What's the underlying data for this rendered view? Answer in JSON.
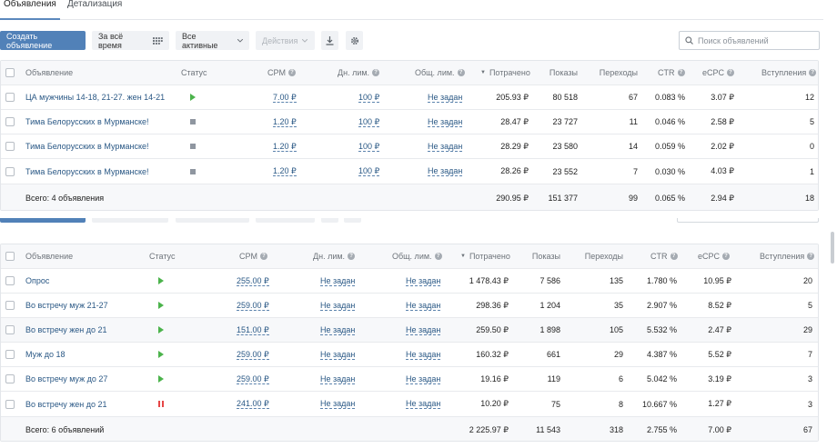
{
  "tabs": [
    {
      "label": "Объявления",
      "active": true
    },
    {
      "label": "Детализация",
      "active": false
    }
  ],
  "toolbar": {
    "create_label": "Создать объявление",
    "period_label": "За всё время",
    "filter_label": "Все активные",
    "actions_label": "Действия",
    "download_icon": "download-icon",
    "settings_icon": "gear-icon",
    "search_placeholder": "Поиск объявлений"
  },
  "colors": {
    "primary": "#5181b8",
    "link": "#2a5885",
    "status_active": "#4bb34b",
    "status_paused": "#e64646",
    "status_stopped": "#8f96a0"
  },
  "table1": {
    "headers": {
      "ad": "Объявление",
      "status": "Статус",
      "cpm": "CPM",
      "daily": "Дн. лим.",
      "total": "Общ. лим.",
      "spent": "Потрачено",
      "impressions": "Показы",
      "clicks": "Переходы",
      "ctr": "CTR",
      "ecpc": "eCPC",
      "joins": "Вступления"
    },
    "rows": [
      {
        "name": "ЦА мужчины 14-18, 21-27. жен 14-21",
        "status": "active",
        "cpm": "7.00 ₽",
        "daily": "100 ₽",
        "total": "Не задан",
        "spent": "205.93 ₽",
        "impressions": "80 518",
        "clicks": "67",
        "ctr": "0.083 %",
        "ecpc": "3.07 ₽",
        "joins": "12"
      },
      {
        "name": "Тима Белорусских в Мурманске!",
        "status": "stopped",
        "cpm": "1.20 ₽",
        "daily": "100 ₽",
        "total": "Не задан",
        "spent": "28.47 ₽",
        "impressions": "23 727",
        "clicks": "11",
        "ctr": "0.046 %",
        "ecpc": "2.58 ₽",
        "joins": "5"
      },
      {
        "name": "Тима Белорусских в Мурманске!",
        "status": "stopped",
        "cpm": "1.20 ₽",
        "daily": "100 ₽",
        "total": "Не задан",
        "spent": "28.29 ₽",
        "impressions": "23 580",
        "clicks": "14",
        "ctr": "0.059 %",
        "ecpc": "2.02 ₽",
        "joins": "0"
      },
      {
        "name": "Тима Белорусских в Мурманске!",
        "status": "stopped",
        "cpm": "1.20 ₽",
        "daily": "100 ₽",
        "total": "Не задан",
        "spent": "28.26 ₽",
        "impressions": "23 552",
        "clicks": "7",
        "ctr": "0.030 %",
        "ecpc": "4.03 ₽",
        "joins": "1"
      }
    ],
    "total": {
      "label": "Всего: 4 объявления",
      "spent": "290.95 ₽",
      "impressions": "151 377",
      "clicks": "99",
      "ctr": "0.065 %",
      "ecpc": "2.94 ₽",
      "joins": "18"
    }
  },
  "table2": {
    "headers": {
      "ad": "Объявление",
      "status": "Статус",
      "cpm": "CPM",
      "daily": "Дн. лим.",
      "total": "Общ. лим.",
      "spent": "Потрачено",
      "impressions": "Показы",
      "clicks": "Переходы",
      "ctr": "CTR",
      "ecpc": "eCPC",
      "joins": "Вступления"
    },
    "rows": [
      {
        "name": "Опрос",
        "status": "active",
        "cpm": "255.00 ₽",
        "daily": "Не задан",
        "total": "Не задан",
        "spent": "1 478.43 ₽",
        "impressions": "7 586",
        "clicks": "135",
        "ctr": "1.780 %",
        "ecpc": "10.95 ₽",
        "joins": "20"
      },
      {
        "name": "Во встречу муж 21-27",
        "status": "active",
        "cpm": "259.00 ₽",
        "daily": "Не задан",
        "total": "Не задан",
        "spent": "298.36 ₽",
        "impressions": "1 204",
        "clicks": "35",
        "ctr": "2.907 %",
        "ecpc": "8.52 ₽",
        "joins": "5"
      },
      {
        "name": "Во встречу жен до 21",
        "status": "active",
        "cpm": "151.00 ₽",
        "daily": "Не задан",
        "total": "Не задан",
        "spent": "259.50 ₽",
        "impressions": "1 898",
        "clicks": "105",
        "ctr": "5.532 %",
        "ecpc": "2.47 ₽",
        "joins": "29"
      },
      {
        "name": "Муж до 18",
        "status": "active",
        "cpm": "259.00 ₽",
        "daily": "Не задан",
        "total": "Не задан",
        "spent": "160.32 ₽",
        "impressions": "661",
        "clicks": "29",
        "ctr": "4.387 %",
        "ecpc": "5.52 ₽",
        "joins": "7"
      },
      {
        "name": "Во встречу муж до 27",
        "status": "active",
        "cpm": "259.00 ₽",
        "daily": "Не задан",
        "total": "Не задан",
        "spent": "19.16 ₽",
        "impressions": "119",
        "clicks": "6",
        "ctr": "5.042 %",
        "ecpc": "3.19 ₽",
        "joins": "3"
      },
      {
        "name": "Во встречу жен до 21",
        "status": "paused",
        "cpm": "241.00 ₽",
        "daily": "Не задан",
        "total": "Не задан",
        "spent": "10.20 ₽",
        "impressions": "75",
        "clicks": "8",
        "ctr": "10.667 %",
        "ecpc": "1.27 ₽",
        "joins": "3"
      }
    ],
    "total": {
      "label": "Всего: 6 объявлений",
      "spent": "2 225.97 ₽",
      "impressions": "11 543",
      "clicks": "318",
      "ctr": "2.755 %",
      "ecpc": "7.00 ₽",
      "joins": "67"
    }
  }
}
